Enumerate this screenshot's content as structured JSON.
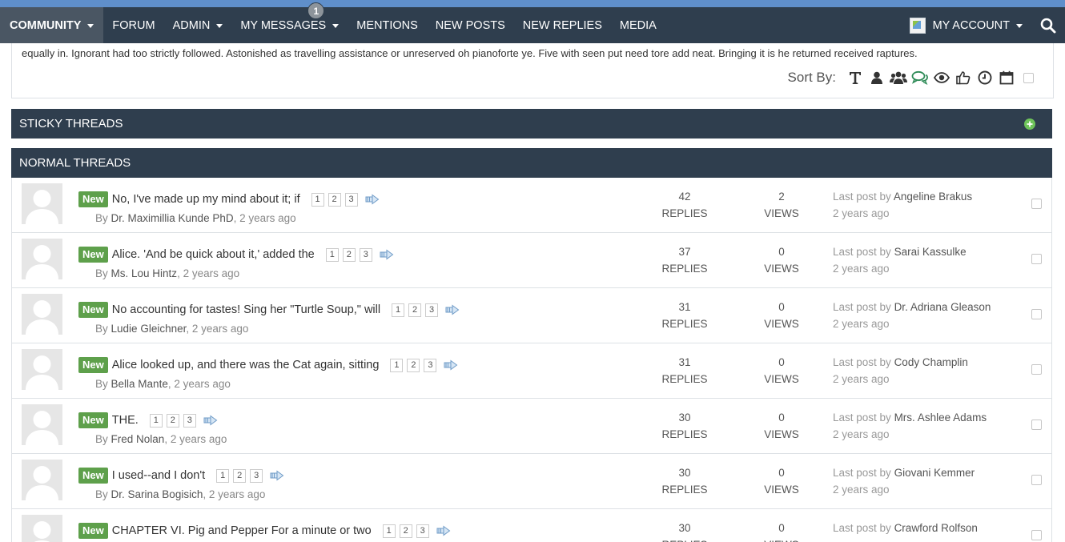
{
  "nav": {
    "items": [
      {
        "label": "COMMUNITY"
      },
      {
        "label": "FORUM"
      },
      {
        "label": "ADMIN"
      },
      {
        "label": "MY MESSAGES",
        "badge": "1"
      },
      {
        "label": "MENTIONS"
      },
      {
        "label": "NEW POSTS"
      },
      {
        "label": "NEW REPLIES"
      },
      {
        "label": "MEDIA"
      }
    ],
    "account_label": "MY ACCOUNT"
  },
  "description": "equally in. Ignorant had too strictly followed. Astonished as travelling assistance or unreserved oh pianoforte ye. Five with seen put need tore add neat. Bringing it is he returned received raptures.",
  "sort": {
    "label": "Sort By:",
    "icons": [
      "title-icon",
      "user-icon",
      "users-icon",
      "comments-icon",
      "eye-icon",
      "thumbs-up-icon",
      "clock-icon",
      "calendar-icon"
    ]
  },
  "sections": {
    "sticky": "STICKY THREADS",
    "normal": "NORMAL THREADS"
  },
  "threads": [
    {
      "title": "No, I've made up my mind about it; if",
      "author": "Dr. Maximillia Kunde PhD",
      "time": "2 years ago",
      "replies": "42",
      "views": "2",
      "last_user": "Angeline Brakus",
      "last_time": "2 years ago"
    },
    {
      "title": "Alice. 'And be quick about it,' added the",
      "author": "Ms. Lou Hintz",
      "time": "2 years ago",
      "replies": "37",
      "views": "0",
      "last_user": "Sarai Kassulke",
      "last_time": "2 years ago"
    },
    {
      "title": "No accounting for tastes! Sing her \"Turtle Soup,\" will",
      "author": "Ludie Gleichner",
      "time": "2 years ago",
      "replies": "31",
      "views": "0",
      "last_user": "Dr. Adriana Gleason",
      "last_time": "2 years ago"
    },
    {
      "title": "Alice looked up, and there was the Cat again, sitting",
      "author": "Bella Mante",
      "time": "2 years ago",
      "replies": "31",
      "views": "0",
      "last_user": "Cody Champlin",
      "last_time": "2 years ago"
    },
    {
      "title": "THE.",
      "author": "Fred Nolan",
      "time": "2 years ago",
      "replies": "30",
      "views": "0",
      "last_user": "Mrs. Ashlee Adams",
      "last_time": "2 years ago"
    },
    {
      "title": "I used--and I don't",
      "author": "Dr. Sarina Bogisich",
      "time": "2 years ago",
      "replies": "30",
      "views": "0",
      "last_user": "Giovani Kemmer",
      "last_time": "2 years ago"
    },
    {
      "title": "CHAPTER VI. Pig and Pepper For a minute or two",
      "author": "",
      "time": "",
      "replies": "30",
      "views": "0",
      "last_user": "Crawford Rolfson",
      "last_time": ""
    }
  ],
  "labels": {
    "new": "New",
    "by": "By",
    "replies": "REPLIES",
    "views": "VIEWS",
    "last_post_by": "Last post by",
    "pages": [
      "1",
      "2",
      "3"
    ]
  },
  "colors": {
    "navbar": "#2f3e4e",
    "topstrip": "#5f8fcb",
    "new_badge": "#5ea04b",
    "add_button": "#6ec35a"
  }
}
